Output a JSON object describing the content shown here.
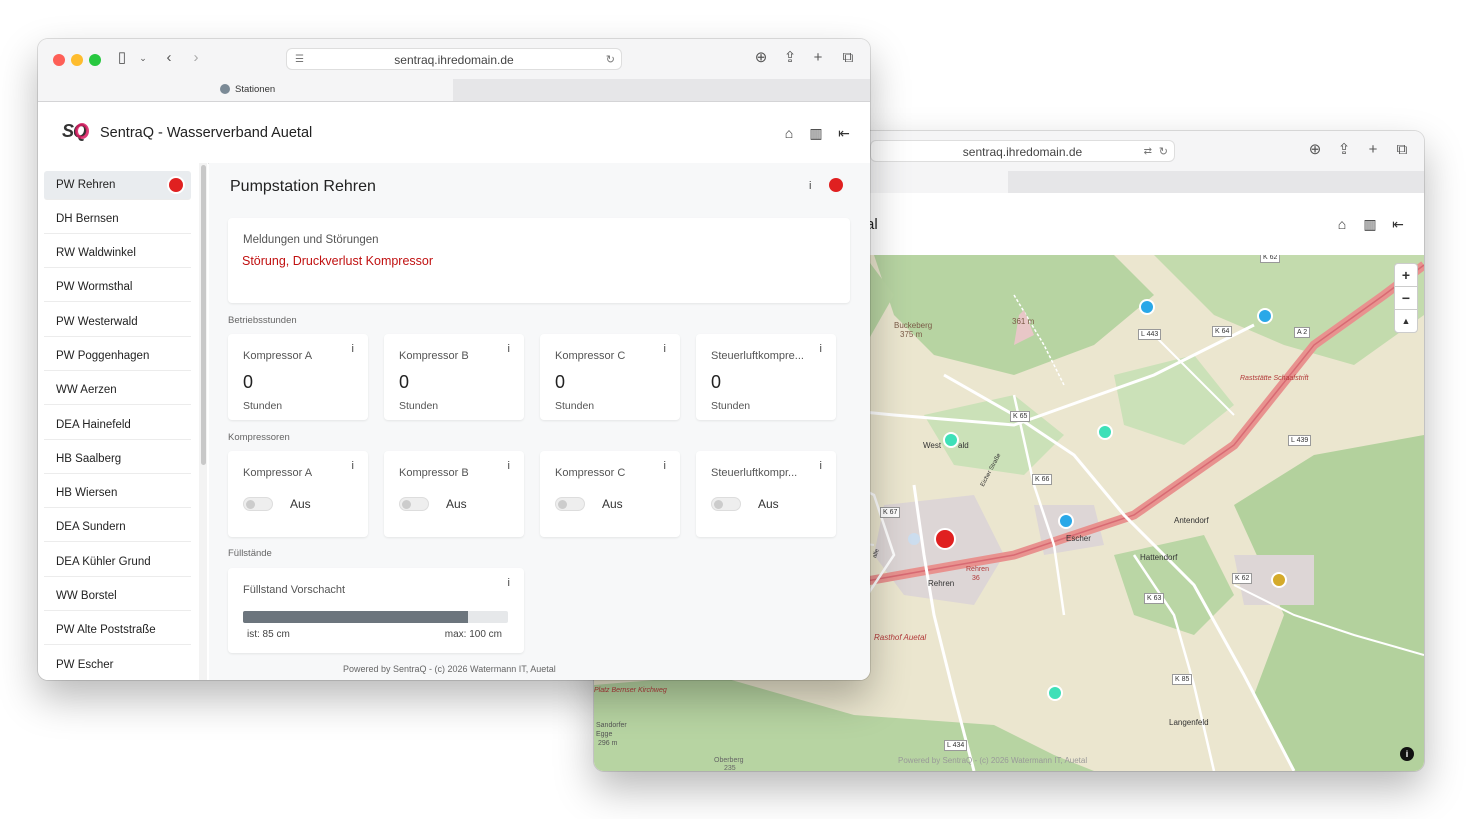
{
  "back_window": {
    "url": "sentraq.ihredomain.de",
    "title_fragment": "al",
    "map": {
      "places": [
        "Buckeberg",
        "375 m",
        "361 m",
        "West",
        "ald",
        "Escher",
        "Antendorf",
        "Hattendorf",
        "Rehren",
        "Langenfeld",
        "Rasthof Auetal",
        "Raststätte Schaafstrift",
        "Rehren",
        "36",
        "Eicher Straße",
        "Oberberg",
        "235",
        "Sandorfer Egge",
        "296 m",
        "Platz Bernser Kirchweg",
        "alle"
      ],
      "roads": [
        "L 443",
        "K 64",
        "A 2",
        "K 65",
        "L 439",
        "K 66",
        "K 67",
        "K 62",
        "K 63",
        "K 85",
        "L 434",
        "K 62"
      ],
      "footer": "Powered by SentraQ - (c) 2026 Watermann IT, Auetal",
      "zoom_in": "+",
      "zoom_out": "−",
      "compass": "▲",
      "info": "i"
    }
  },
  "front_window": {
    "url": "sentraq.ihredomain.de",
    "tab_title": "Stationen",
    "logo": "SQ",
    "app_title": "SentraQ - Wasserverband Auetal",
    "sidebar": [
      {
        "label": "PW Rehren"
      },
      {
        "label": "DH Bernsen"
      },
      {
        "label": "RW Waldwinkel"
      },
      {
        "label": "PW Wormsthal"
      },
      {
        "label": "PW Westerwald"
      },
      {
        "label": "PW Poggenhagen"
      },
      {
        "label": "WW Aerzen"
      },
      {
        "label": "DEA Hainefeld"
      },
      {
        "label": "HB Saalberg"
      },
      {
        "label": "HB Wiersen"
      },
      {
        "label": "DEA Sundern"
      },
      {
        "label": "DEA Kühler Grund"
      },
      {
        "label": "WW Borstel"
      },
      {
        "label": "PW Alte Poststraße"
      },
      {
        "label": "PW Escher"
      }
    ],
    "station_title": "Pumpstation Rehren",
    "info_label": "i",
    "messages": {
      "title": "Meldungen und Störungen",
      "text": "Störung, Druckverlust Kompressor",
      "color": "#c01010"
    },
    "hours": {
      "section": "Betriebsstunden",
      "items": [
        {
          "title": "Kompressor A",
          "value": "0",
          "unit": "Stunden"
        },
        {
          "title": "Kompressor B",
          "value": "0",
          "unit": "Stunden"
        },
        {
          "title": "Kompressor C",
          "value": "0",
          "unit": "Stunden"
        },
        {
          "title": "Steuerluftkompre...",
          "value": "0",
          "unit": "Stunden"
        }
      ]
    },
    "compressors": {
      "section": "Kompressoren",
      "items": [
        {
          "title": "Kompressor A",
          "state": "Aus"
        },
        {
          "title": "Kompressor B",
          "state": "Aus"
        },
        {
          "title": "Kompressor C",
          "state": "Aus"
        },
        {
          "title": "Steuerluftkompr...",
          "state": "Aus"
        }
      ]
    },
    "levels": {
      "section": "Füllstände",
      "title": "Füllstand Vorschacht",
      "fill_fraction": 0.85,
      "current": "ist: 85 cm",
      "max": "max: 100 cm"
    },
    "footer": "Powered by SentraQ - (c) 2026 Watermann IT, Auetal",
    "status_color": "#e02020"
  }
}
